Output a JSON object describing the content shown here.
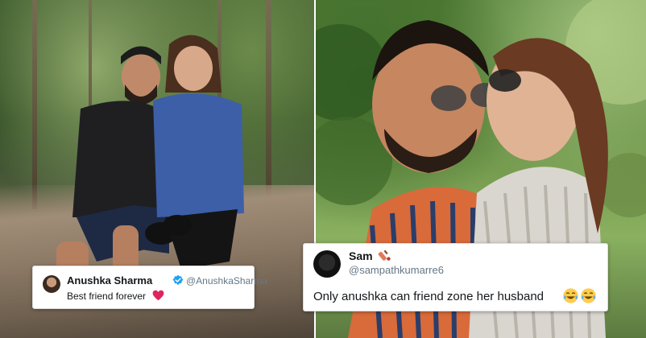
{
  "tweets": {
    "left": {
      "name": "Anushka Sharma",
      "handle": "@AnushkaSharma",
      "text": "Best friend forever",
      "icons": [
        "verified-badge-icon",
        "red-heart-icon"
      ]
    },
    "right": {
      "name": "Sam",
      "handle": "@sampathkumarre6",
      "text": "Only anushka can friend zone her husband",
      "icons": [
        "cricket-bat-icon",
        "tears-of-joy-emoji-icon",
        "tears-of-joy-emoji-icon"
      ]
    }
  },
  "colors": {
    "verified": "#1da1f2",
    "heart": "#e0245e",
    "handle_text": "#657786",
    "name_text": "#14171a"
  }
}
